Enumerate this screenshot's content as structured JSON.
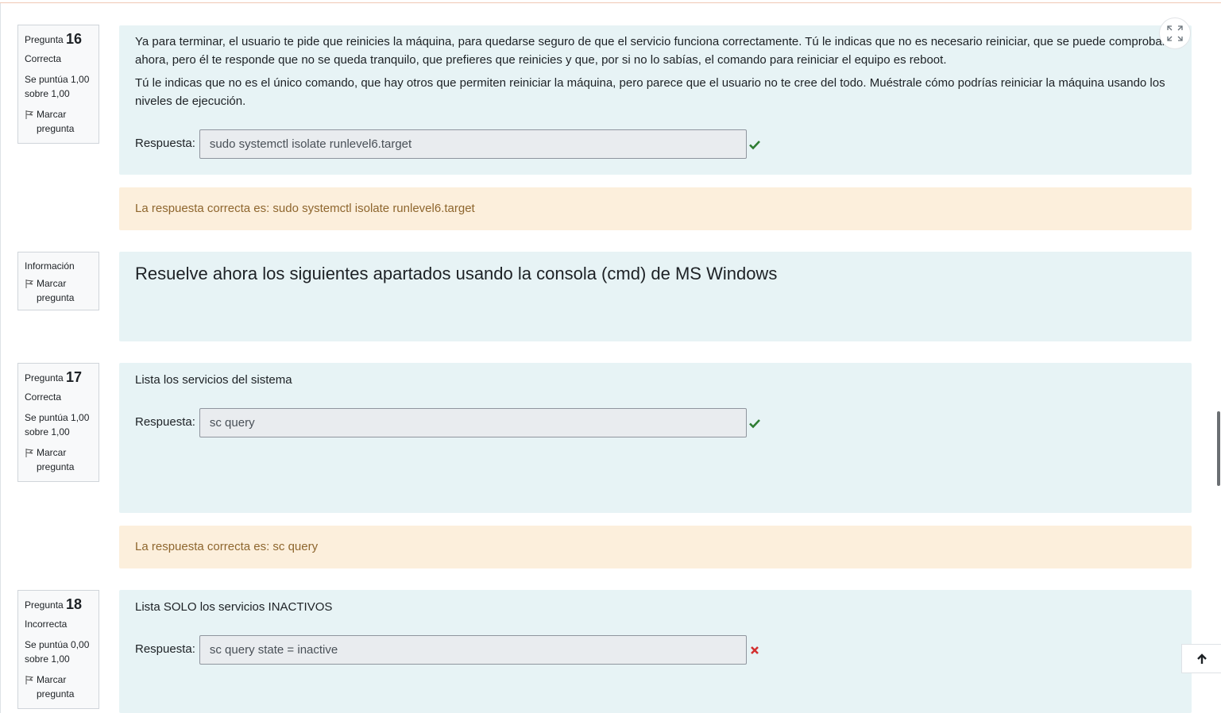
{
  "common": {
    "flag_label": "Marcar pregunta",
    "answer_label": "Respuesta:"
  },
  "q16": {
    "prefix": "Pregunta",
    "number": "16",
    "state": "Correcta",
    "grade": "Se puntúa 1,00 sobre 1,00",
    "para1": "Ya para terminar, el usuario te pide que reinicies la máquina, para quedarse seguro de que el servicio funciona correctamente. Tú le indicas que no es necesario reiniciar, que se puede comprobar ahora, pero él te responde que no se queda tranquilo, que prefieres que reinicies y que, por si no lo sabías, el comando para reiniciar el equipo es reboot.",
    "para2": "Tú le indicas que no es el único comando, que hay otros que permiten reiniciar la máquina, pero parece que el usuario no te cree del todo. Muéstrale cómo podrías reiniciar la máquina usando los niveles de ejecución.",
    "answer": "sudo systemctl isolate runlevel6.target",
    "result_icon": "check-icon",
    "feedback": "La respuesta correcta es: sudo systemctl isolate runlevel6.target"
  },
  "info": {
    "label": "Información",
    "heading": "Resuelve ahora los siguientes apartados usando la consola (cmd) de MS Windows"
  },
  "q17": {
    "prefix": "Pregunta",
    "number": "17",
    "state": "Correcta",
    "grade": "Se puntúa 1,00 sobre 1,00",
    "text": "Lista los servicios del sistema",
    "answer": "sc query",
    "result_icon": "check-icon",
    "feedback": "La respuesta correcta es: sc query"
  },
  "q18": {
    "prefix": "Pregunta",
    "number": "18",
    "state": "Incorrecta",
    "grade": "Se puntúa 0,00 sobre 1,00",
    "text": "Lista SOLO los servicios INACTIVOS",
    "answer": "sc query state = inactive",
    "result_icon": "cross-icon"
  },
  "colors": {
    "question_bg": "#e7f3f5",
    "feedback_bg": "#fcefdc",
    "feedback_text": "#8e662e",
    "correct": "#2e7d32",
    "incorrect": "#d32f2f"
  },
  "controls": {
    "fullscreen_icon": "expand-icon",
    "back_to_top_icon": "arrow-up-icon"
  }
}
